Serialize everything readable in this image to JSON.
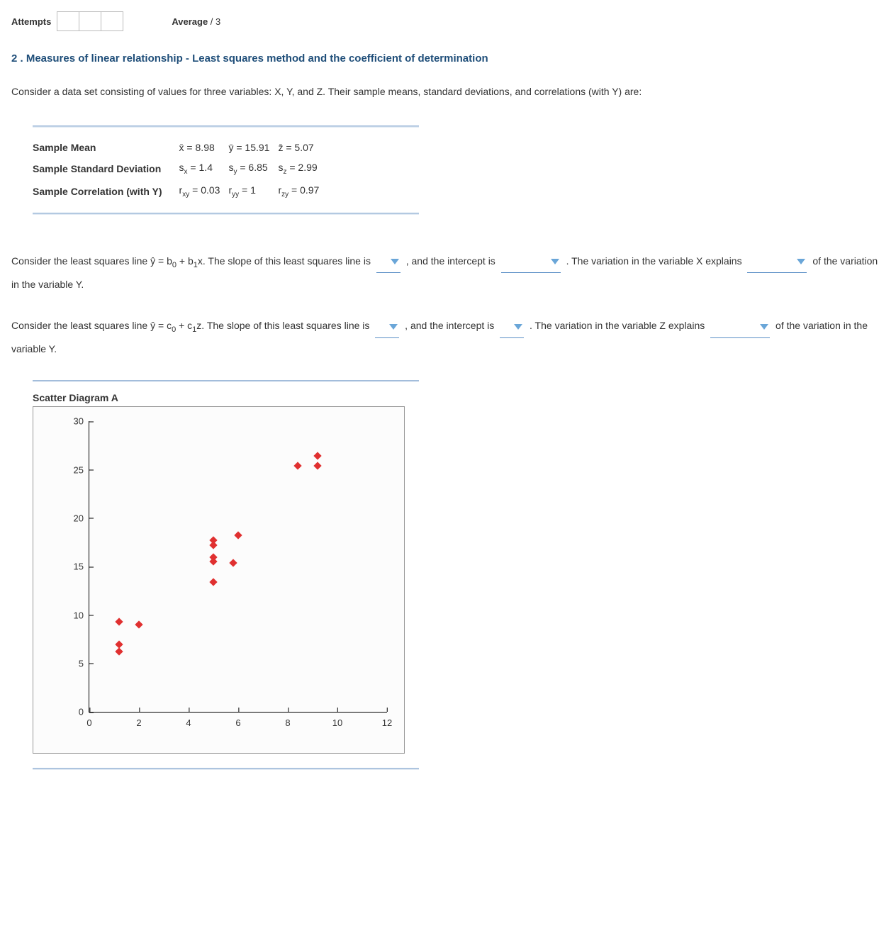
{
  "header": {
    "attempts_label": "Attempts",
    "average_label": "Average",
    "average_denom": "/ 3"
  },
  "question": {
    "title": "2 . Measures of linear relationship - Least squares method and the coefficient of determination",
    "intro": "Consider a data set consisting of values for three variables: X, Y, and Z. Their sample means, standard deviations, and correlations (with Y) are:"
  },
  "stats": {
    "rows": [
      {
        "label": "Sample Mean"
      },
      {
        "label": "Sample Standard Deviation"
      },
      {
        "label": "Sample Correlation (with Y)"
      }
    ],
    "mean_x": "8.98",
    "mean_y": "15.91",
    "mean_z": "5.07",
    "sd_x": "1.4",
    "sd_y": "6.85",
    "sd_z": "2.99",
    "r_xy": "0.03",
    "r_yy": "1",
    "r_zy": "0.97"
  },
  "p1": {
    "a": "Consider the least squares line ŷ = b",
    "b": " + b",
    "c": "x. The slope of this least squares line is ",
    "d": " , and the intercept is ",
    "e": " . The variation in the variable X explains ",
    "f": " of the variation in the variable Y."
  },
  "p2": {
    "a": "Consider the least squares line ŷ = c",
    "b": " + c",
    "c": "z. The slope of this least squares line is ",
    "d": " , and the intercept is ",
    "e": " . The variation in the variable Z explains ",
    "f": " of the variation in the variable Y."
  },
  "scatter": {
    "title": "Scatter Diagram A"
  },
  "chart_data": {
    "type": "scatter",
    "title": "Scatter Diagram A",
    "xlabel": "",
    "ylabel": "",
    "xlim": [
      0,
      12
    ],
    "ylim": [
      0,
      30
    ],
    "xticks": [
      0,
      2,
      4,
      6,
      8,
      10,
      12
    ],
    "yticks": [
      0,
      5,
      10,
      15,
      20,
      25,
      30
    ],
    "series": [
      {
        "name": "points",
        "color": "#e03030",
        "points": [
          {
            "x": 1.2,
            "y": 9.3
          },
          {
            "x": 2.0,
            "y": 9.0
          },
          {
            "x": 1.2,
            "y": 7.0
          },
          {
            "x": 1.2,
            "y": 6.2
          },
          {
            "x": 5.0,
            "y": 17.2
          },
          {
            "x": 5.0,
            "y": 17.7
          },
          {
            "x": 5.0,
            "y": 16.0
          },
          {
            "x": 5.0,
            "y": 15.5
          },
          {
            "x": 6.0,
            "y": 18.2
          },
          {
            "x": 5.0,
            "y": 13.4
          },
          {
            "x": 5.8,
            "y": 15.4
          },
          {
            "x": 8.4,
            "y": 25.4
          },
          {
            "x": 9.2,
            "y": 26.4
          },
          {
            "x": 9.2,
            "y": 25.4
          }
        ]
      }
    ]
  }
}
